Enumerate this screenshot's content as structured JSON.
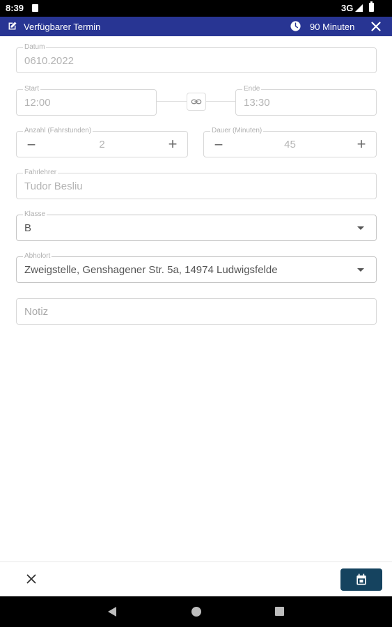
{
  "status_bar": {
    "time": "8:39",
    "network": "3G"
  },
  "header": {
    "title": "Verfügbarer Termin",
    "duration": "90 Minuten",
    "icons": [
      "edit-icon",
      "clock-icon",
      "close-icon"
    ],
    "background_color": "#283593"
  },
  "form": {
    "date": {
      "label": "Datum",
      "value": "0610.2022"
    },
    "start": {
      "label": "Start",
      "value": "12:00"
    },
    "end": {
      "label": "Ende",
      "value": "13:30"
    },
    "lesson_count": {
      "label": "Anzahl (Fahrstunden)",
      "value": "2"
    },
    "duration_minutes": {
      "label": "Dauer (Minuten)",
      "value": "45"
    },
    "instructor": {
      "label": "Fahrlehrer",
      "value": "Tudor Besliu"
    },
    "class": {
      "label": "Klasse",
      "value": "B"
    },
    "pickup": {
      "label": "Abholort",
      "value": "Zweigstelle, Genshagener Str. 5a, 14974 Ludwigsfelde"
    },
    "note": {
      "placeholder": "Notiz"
    }
  },
  "bottom_bar": {
    "accent_color": "#15435f",
    "icons": [
      "close-icon",
      "calendar-icon"
    ]
  }
}
